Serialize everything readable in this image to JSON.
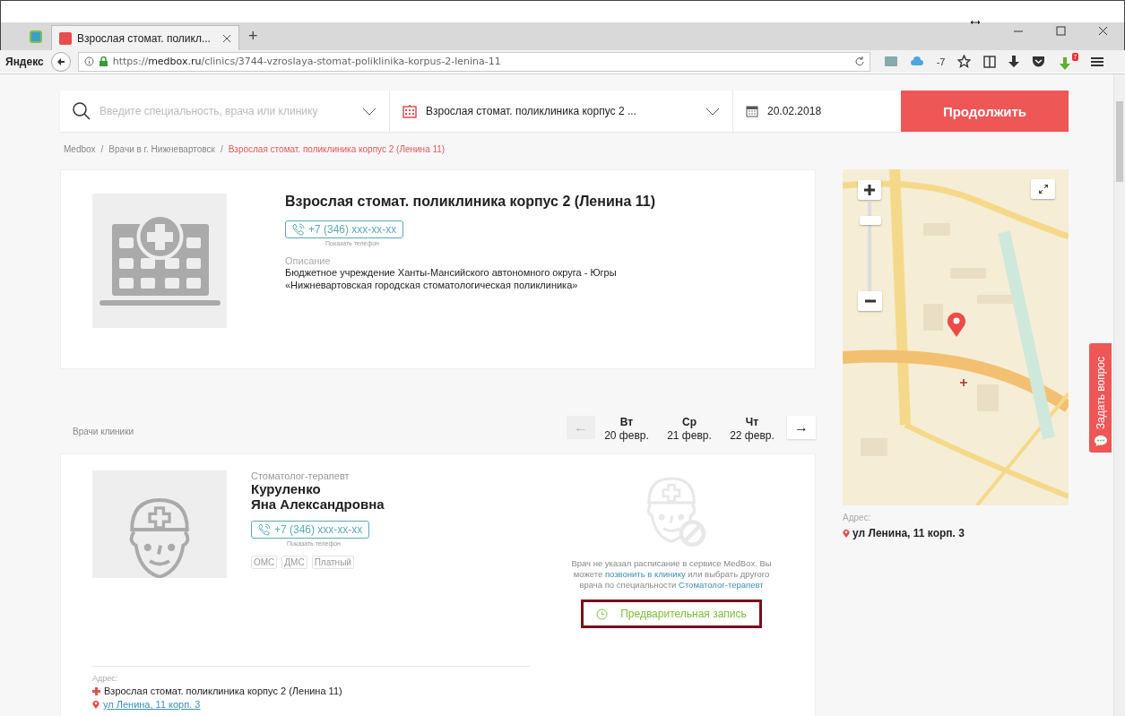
{
  "browser": {
    "tabs": [
      {
        "title": "Взрослая стомат. поликл...",
        "selected": true
      }
    ],
    "new_tab": "+",
    "brand": "Яндекс",
    "url": "https://**medbox.ru**/clinics/3744-vzroslaya-stomat-poliklinika-korpus-2-lenina-11",
    "weather": "-7",
    "extension_badge": "7"
  },
  "search": {
    "placeholder": "Введите специальность, врача или клинику",
    "clinic": "Взрослая стомат. поликлиника корпус 2 ...",
    "date": "20.02.2018",
    "button": "Продолжить"
  },
  "breadcrumbs": [
    {
      "label": "Medbox",
      "current": false
    },
    {
      "label": "Врачи в г. Нижневартовск",
      "current": false
    },
    {
      "label": "Взрослая стомат. поликлиника корпус 2 (Ленина 11)",
      "current": true
    }
  ],
  "breadcrumb_separator": "/",
  "clinic": {
    "name": "Взрослая стомат. поликлиника корпус 2 (Ленина 11)",
    "phone": "+7 (346) xxx-xx-xx",
    "phone_hint": "Показать телефон",
    "description_label": "Описание",
    "description": [
      "Бюджетное учреждение Ханты-Мансийского автономного округа - Югры",
      "«Нижневартовская городская стоматологическая поликлиника»"
    ]
  },
  "map": {
    "address_label": "Адрес:",
    "address": "ул Ленина, 11 корп. 3"
  },
  "doctors": {
    "title": "Врачи клиники",
    "prev": "←",
    "prev_disabled": true,
    "next": "→",
    "next_disabled": false,
    "days": [
      {
        "weekday": "Вт",
        "date": "20 февр."
      },
      {
        "weekday": "Ср",
        "date": "21 февр."
      },
      {
        "weekday": "Чт",
        "date": "22 февр."
      }
    ],
    "items": [
      {
        "specialty": "Стоматолог-терапевт",
        "name": [
          "Куруленко",
          "Яна Александровна"
        ],
        "phone": "+7 (346) xxx-xx-xx",
        "phone_hint": "Показать телефон",
        "tags": [
          {
            "label": "ОМС",
            "disabled": true
          },
          {
            "label": "ДМС",
            "disabled": true
          },
          {
            "label": "Платный",
            "disabled": true
          }
        ],
        "notice": [
          {
            "text": "Врач не указал расписание в сервисе MedBox. Вы можете ",
            "link": false
          },
          {
            "text": "позвонить в клинику",
            "link": true
          },
          {
            "text": " или выбрать другого врача по специальности ",
            "link": false
          },
          {
            "text": "Стоматолог-терапевт",
            "link": true
          }
        ],
        "booking_button": "Предварительная запись",
        "booking_highlighted": true,
        "address_label": "Адрес:",
        "clinic": "Взрослая стомат. поликлиника корпус 2 (Ленина 11)",
        "address": "ул Ленина, 11 корп. 3"
      }
    ]
  },
  "feedback": "Задать вопрос"
}
